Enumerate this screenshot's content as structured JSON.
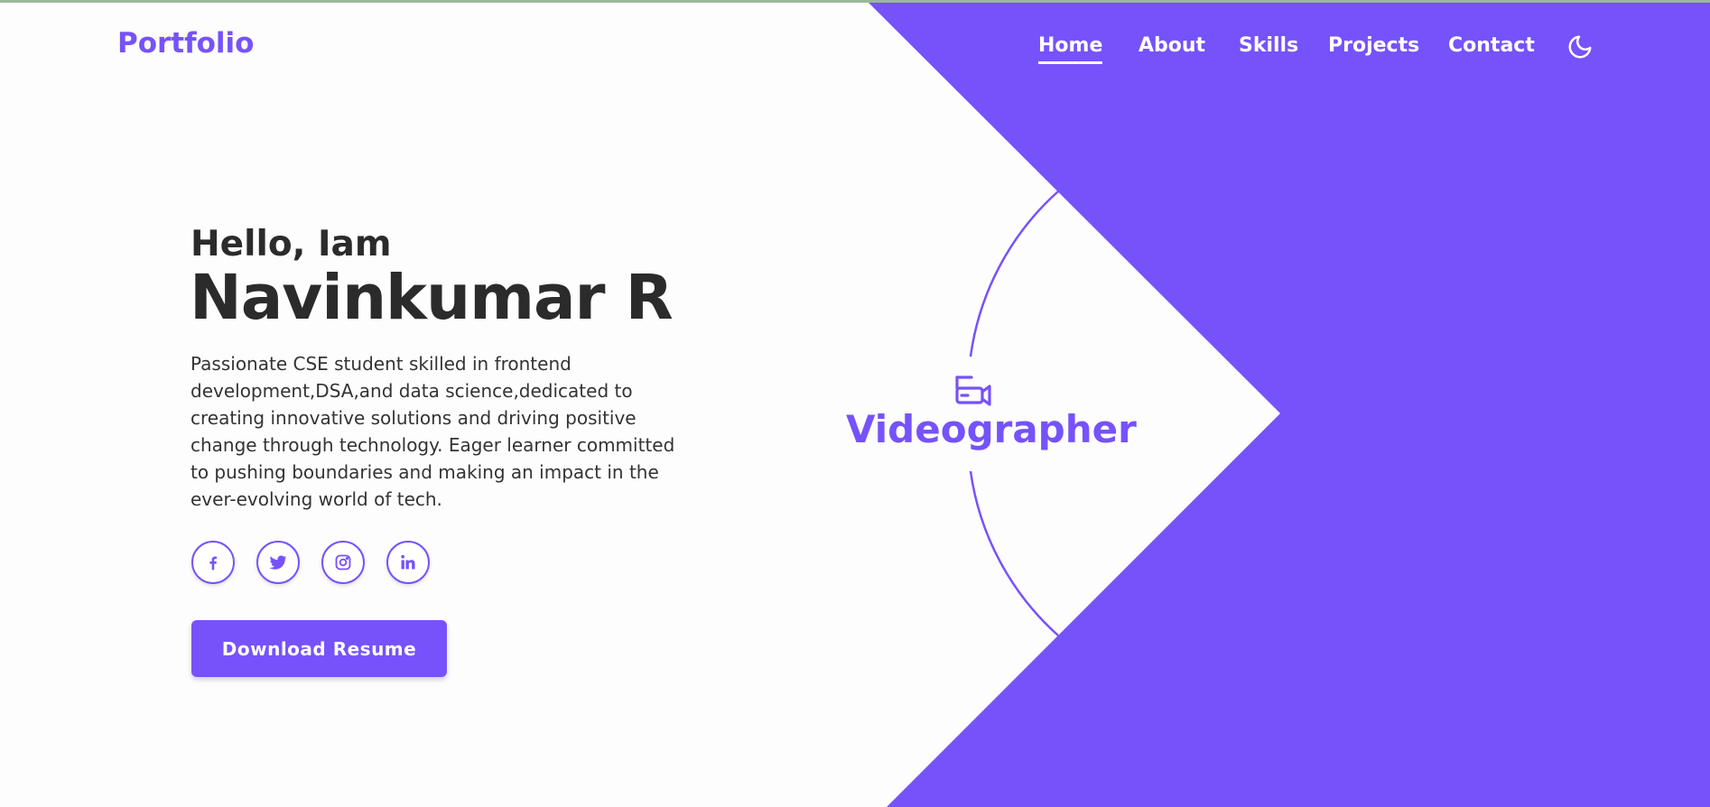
{
  "nav": {
    "logo": "Portfolio",
    "items": [
      {
        "label": "Home",
        "active": true
      },
      {
        "label": "About",
        "active": false
      },
      {
        "label": "Skills",
        "active": false
      },
      {
        "label": "Projects",
        "active": false
      },
      {
        "label": "Contact",
        "active": false
      }
    ],
    "theme_toggle_icon": "moon-icon"
  },
  "hero": {
    "greeting": "Hello, Iam",
    "name": "Navinkumar R",
    "description": "Passionate CSE student skilled in frontend development,DSA,and data science,dedicated to creating innovative solutions and driving positive change through technology. Eager learner committed to pushing boundaries and making an impact in the ever-evolving world of tech.",
    "socials": [
      "facebook-icon",
      "twitter-icon",
      "instagram-icon",
      "linkedin-icon"
    ],
    "download_label": "Download Resume"
  },
  "role": {
    "icon": "video-camera-icon",
    "text": "Videographer"
  },
  "colors": {
    "accent": "#7652fb",
    "background": "#fdfdfd",
    "text_dark": "#2b2b2b",
    "text_body": "#333333"
  }
}
